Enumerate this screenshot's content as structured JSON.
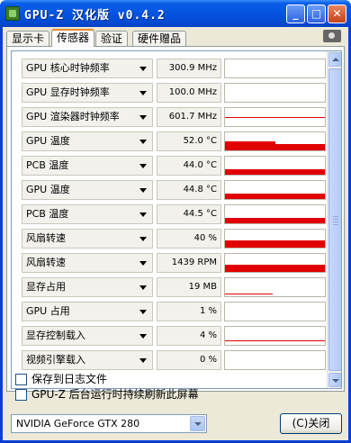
{
  "window": {
    "title": "GPU-Z 汉化版 v0.4.2",
    "min_glyph": "_",
    "max_glyph": "□",
    "close_glyph": "✕"
  },
  "tabs": [
    {
      "label": "显示卡",
      "active": false
    },
    {
      "label": "传感器",
      "active": true
    },
    {
      "label": "验证",
      "active": false
    },
    {
      "label": "硬件赠品",
      "active": false
    }
  ],
  "sensors": [
    {
      "name": "GPU 核心时钟频率",
      "value": "300.9 MHz",
      "graph": {
        "kind": "none"
      }
    },
    {
      "name": "GPU 显存时钟频率",
      "value": "100.0 MHz",
      "graph": {
        "kind": "none"
      }
    },
    {
      "name": "GPU 渲染器时钟频率",
      "value": "601.7 MHz",
      "graph": {
        "kind": "line",
        "level": 0.45
      }
    },
    {
      "name": "GPU 温度",
      "value": "52.0 °C",
      "graph": {
        "kind": "bar",
        "level": 0.35,
        "peak": 0.5
      }
    },
    {
      "name": "PCB 温度",
      "value": "44.0 °C",
      "graph": {
        "kind": "bar",
        "level": 0.3
      }
    },
    {
      "name": "GPU 温度",
      "value": "44.8 °C",
      "graph": {
        "kind": "bar",
        "level": 0.3
      }
    },
    {
      "name": "PCB 温度",
      "value": "44.5 °C",
      "graph": {
        "kind": "bar",
        "level": 0.3
      }
    },
    {
      "name": "风扇转速",
      "value": "40 %",
      "graph": {
        "kind": "bar",
        "level": 0.4
      }
    },
    {
      "name": "风扇转速",
      "value": "1439 RPM",
      "graph": {
        "kind": "bar",
        "level": 0.4
      }
    },
    {
      "name": "显存占用",
      "value": "19 MB",
      "graph": {
        "kind": "line",
        "level": 0.1,
        "span": 0.48
      }
    },
    {
      "name": "GPU 占用",
      "value": "1 %",
      "graph": {
        "kind": "none"
      }
    },
    {
      "name": "显存控制载入",
      "value": "4 %",
      "graph": {
        "kind": "line",
        "level": 0.2
      }
    },
    {
      "name": "视频引擎载入",
      "value": "0 %",
      "graph": {
        "kind": "none"
      }
    }
  ],
  "options": {
    "log_to_file": "保存到日志文件",
    "continue_refresh": "GPU-Z 后台运行时持续刷新此屏幕"
  },
  "device": {
    "selected": "NVIDIA GeForce GTX 280"
  },
  "buttons": {
    "close": "(C)关闭"
  },
  "colors": {
    "graph": "#e00000",
    "titlebar": "#0554e0",
    "client": "#ece9d8"
  },
  "icons": {
    "camera": "camera-icon",
    "app": "gpu-z-app-icon"
  }
}
